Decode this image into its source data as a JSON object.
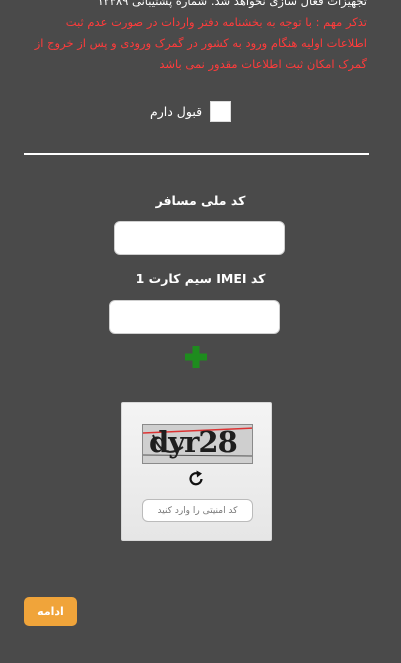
{
  "notice": {
    "line_top": "تجهیزات فعال سازی نخواهد شد. شماره پشتیبانی ۱۲۳۸۹",
    "warning": "تذکر مهم : با توجه به بخشنامه دفتر واردات در صورت عدم ثبت اطلاعات اولیه هنگام ورود به کشور در گمرک ورودی و پس از خروج از گمرک امکان ثبت اطلاعات مقدور نمی باشد",
    "warning_color": "#ff3b3b"
  },
  "accept": {
    "label": "قبول دارم",
    "checked": false
  },
  "form": {
    "national_code_label": "کد ملی مسافر",
    "national_code_value": "",
    "imei_label": "کد IMEI سیم کارت 1",
    "imei_value": "",
    "add_icon": "plus-icon",
    "add_color": "#1e8c1e"
  },
  "captcha": {
    "image_text": "dyr28",
    "refresh_icon": "refresh-icon",
    "placeholder": "کد امنیتی را وارد کنید",
    "value": ""
  },
  "continue_button": {
    "label": "ادامه",
    "color": "#f0a43a"
  }
}
